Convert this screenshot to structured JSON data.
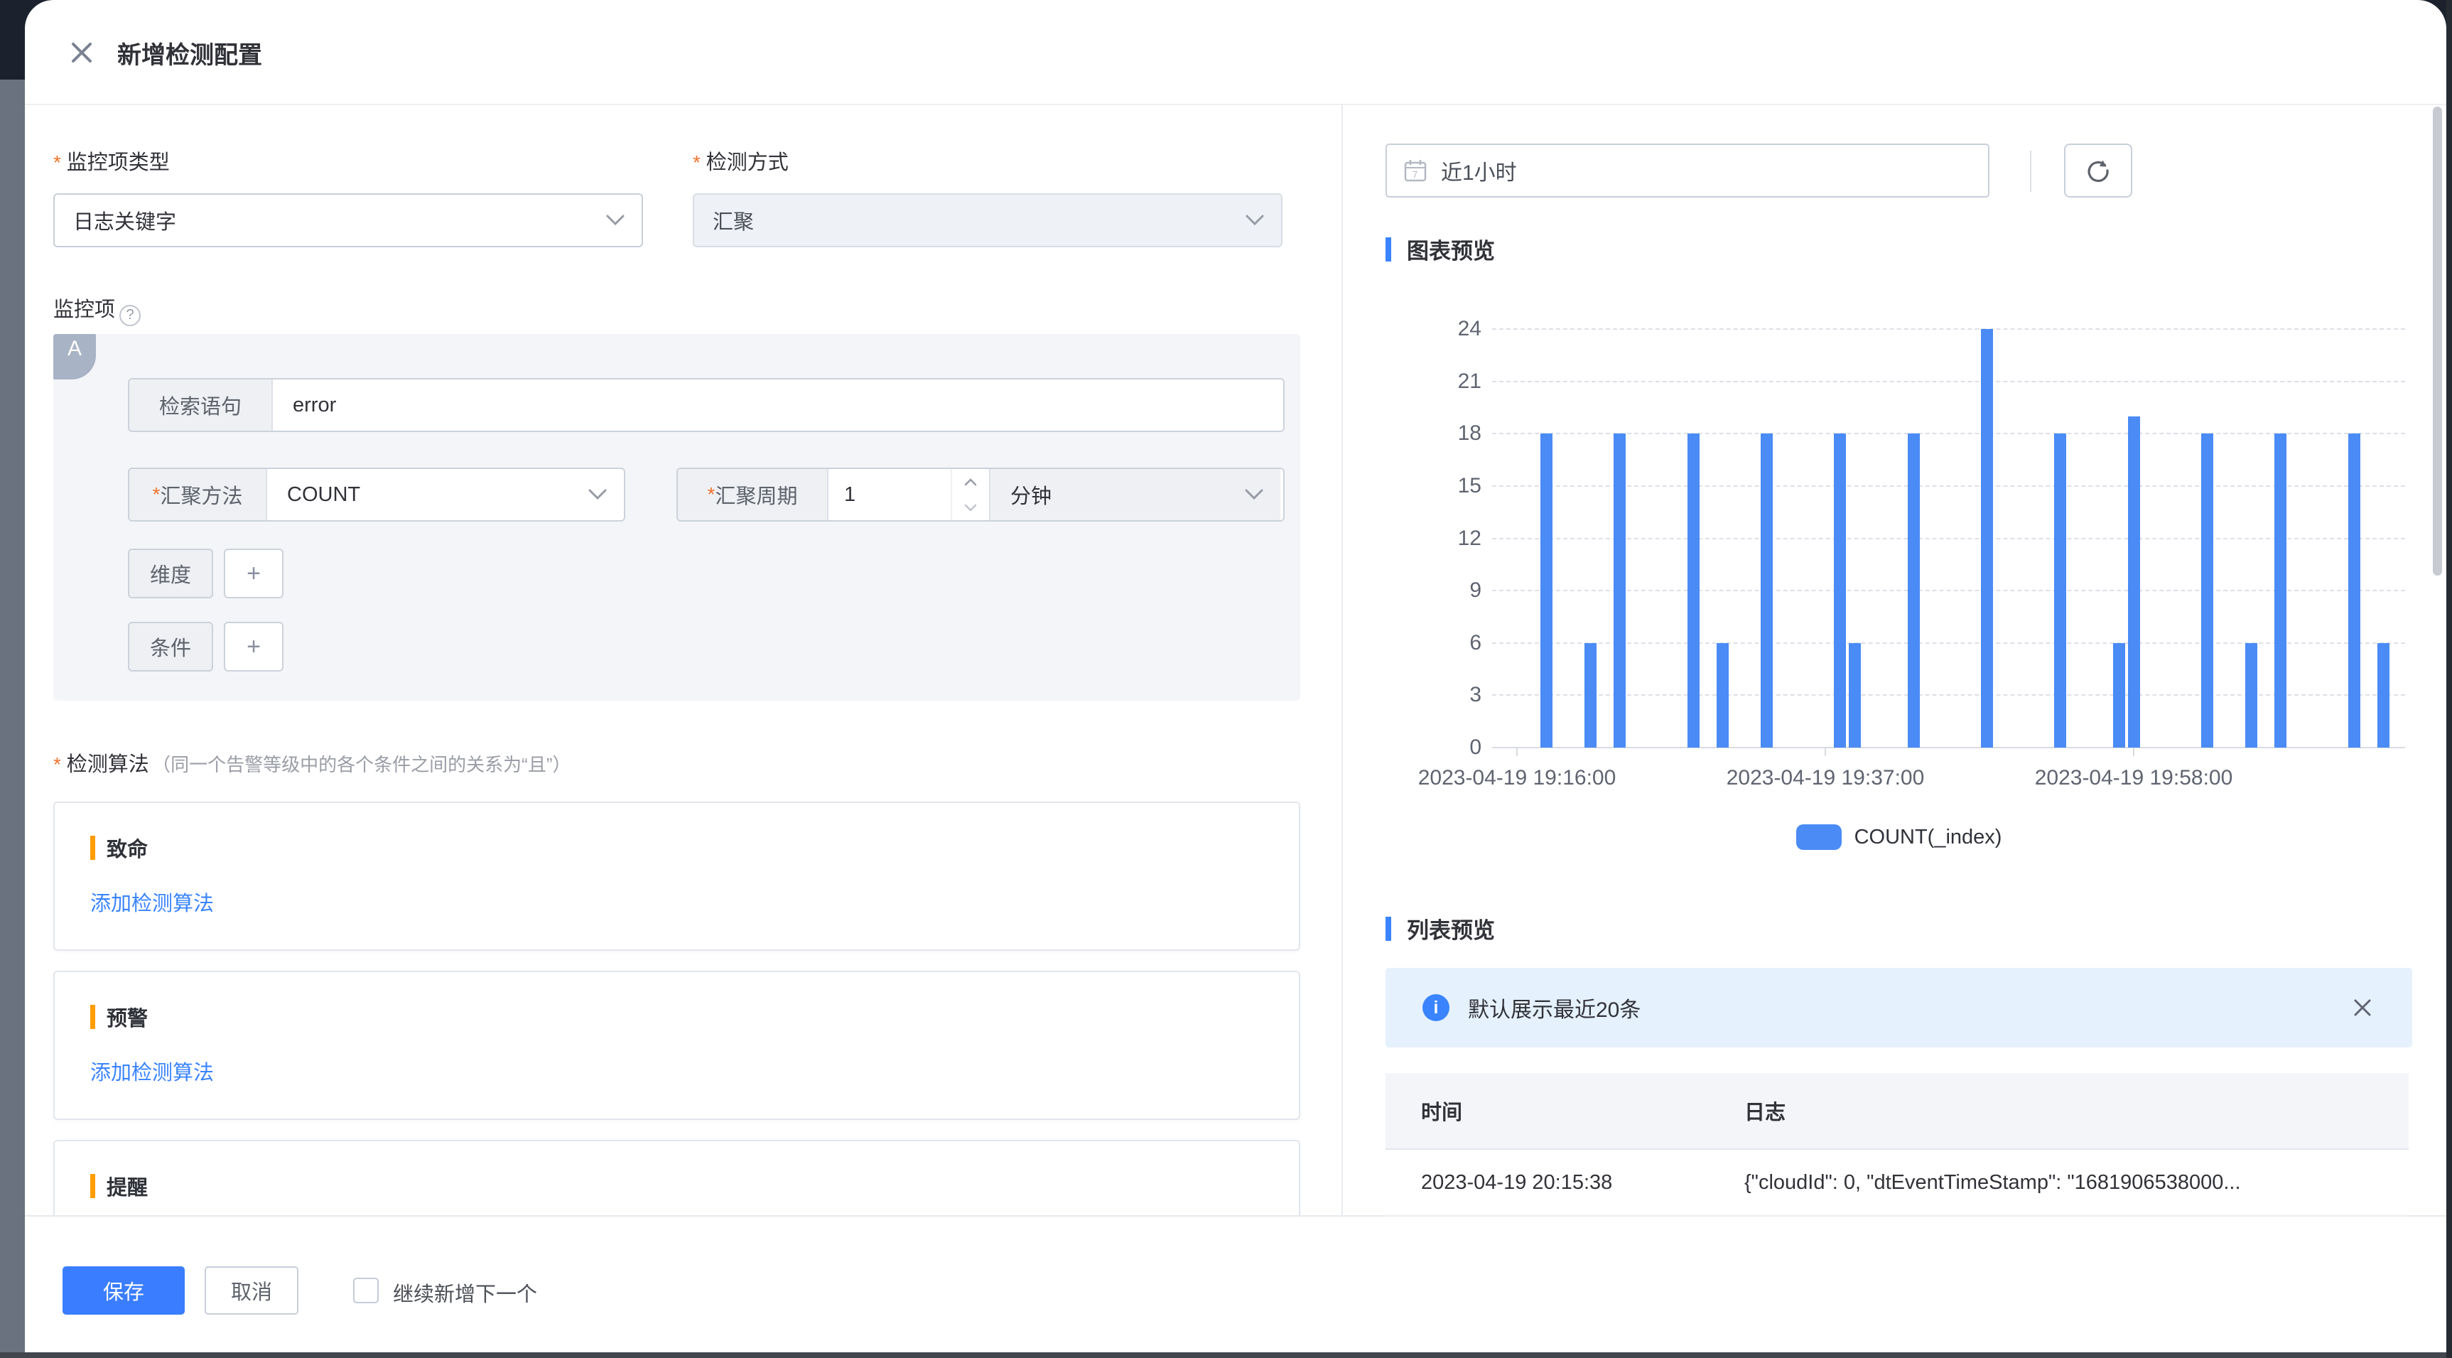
{
  "drawer": {
    "title": "新增检测配置"
  },
  "form": {
    "monitor_type": {
      "label": "监控项类型",
      "value": "日志关键字"
    },
    "detect_method": {
      "label": "检测方式",
      "value": "汇聚"
    },
    "monitor_item_label": "监控项",
    "group": {
      "tag": "A",
      "query_label": "检索语句",
      "query_value": "error",
      "agg_method_label": "汇聚方法",
      "agg_method_value": "COUNT",
      "agg_period_label": "汇聚周期",
      "agg_period_value": "1",
      "agg_period_unit": "分钟",
      "dimension_label": "维度",
      "condition_label": "条件",
      "add_button": "+"
    },
    "algorithm": {
      "label": "检测算法",
      "note": "（同一个告警等级中的各个条件之间的关系为“且”）",
      "levels": [
        {
          "name": "致命",
          "link": "添加检测算法"
        },
        {
          "name": "预警",
          "link": "添加检测算法"
        },
        {
          "name": "提醒",
          "link": ""
        }
      ]
    }
  },
  "footer": {
    "save": "保存",
    "cancel": "取消",
    "continue_label": "继续新增下一个",
    "continue_checked": false
  },
  "preview": {
    "time_range": "近1小时",
    "chart_section": "图表预览",
    "list_section": "列表预览",
    "alert": "默认展示最近20条",
    "table": {
      "columns": [
        "时间",
        "日志"
      ],
      "rows": [
        {
          "time": "2023-04-19 20:15:38",
          "log": "{\"cloudId\": 0, \"dtEventTimeStamp\": \"1681906538000..."
        }
      ]
    }
  },
  "chart_data": {
    "type": "bar",
    "title": "图表预览",
    "legend": [
      {
        "name": "COUNT(_index)",
        "color": "#4a8bf5"
      }
    ],
    "ylim": [
      0,
      24
    ],
    "y_ticks": [
      0,
      3,
      6,
      9,
      12,
      15,
      18,
      21,
      24
    ],
    "grid": "dashed-horizontal",
    "legend_position": "bottom",
    "x_ticks": [
      {
        "label": "2023-04-19 19:16:00",
        "minute": 0
      },
      {
        "label": "2023-04-19 19:37:00",
        "minute": 21
      },
      {
        "label": "2023-04-19 19:58:00",
        "minute": 42
      }
    ],
    "bars": [
      {
        "minute": 2,
        "value": 18
      },
      {
        "minute": 5,
        "value": 6
      },
      {
        "minute": 7,
        "value": 18
      },
      {
        "minute": 12,
        "value": 18
      },
      {
        "minute": 14,
        "value": 6
      },
      {
        "minute": 17,
        "value": 18
      },
      {
        "minute": 22,
        "value": 18
      },
      {
        "minute": 23,
        "value": 6
      },
      {
        "minute": 27,
        "value": 18
      },
      {
        "minute": 32,
        "value": 24
      },
      {
        "minute": 37,
        "value": 18
      },
      {
        "minute": 41,
        "value": 6
      },
      {
        "minute": 42,
        "value": 19
      },
      {
        "minute": 47,
        "value": 18
      },
      {
        "minute": 50,
        "value": 6
      },
      {
        "minute": 52,
        "value": 18
      },
      {
        "minute": 57,
        "value": 18
      },
      {
        "minute": 59,
        "value": 6
      }
    ]
  }
}
